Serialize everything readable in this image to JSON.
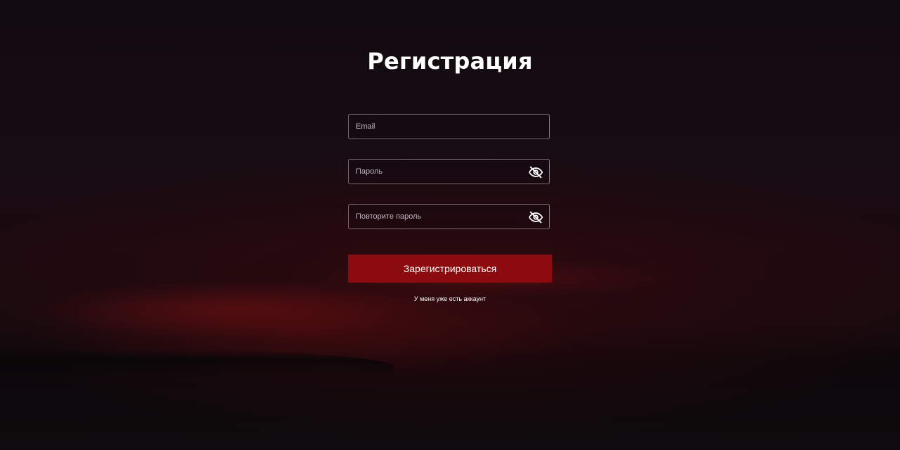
{
  "page": {
    "title": "Регистрация"
  },
  "form": {
    "email": {
      "placeholder": "Email",
      "value": ""
    },
    "password": {
      "placeholder": "Пароль",
      "value": "",
      "icon": "eye-off-icon"
    },
    "repeat_password": {
      "placeholder": "Повторите пароль",
      "value": "",
      "icon": "eye-off-icon"
    },
    "submit_label": "Зарегистрироваться",
    "login_link": "У меня уже есть аккаунт"
  },
  "colors": {
    "accent": "#8b0b0e",
    "background": "#140b10",
    "text": "#ffffff"
  }
}
